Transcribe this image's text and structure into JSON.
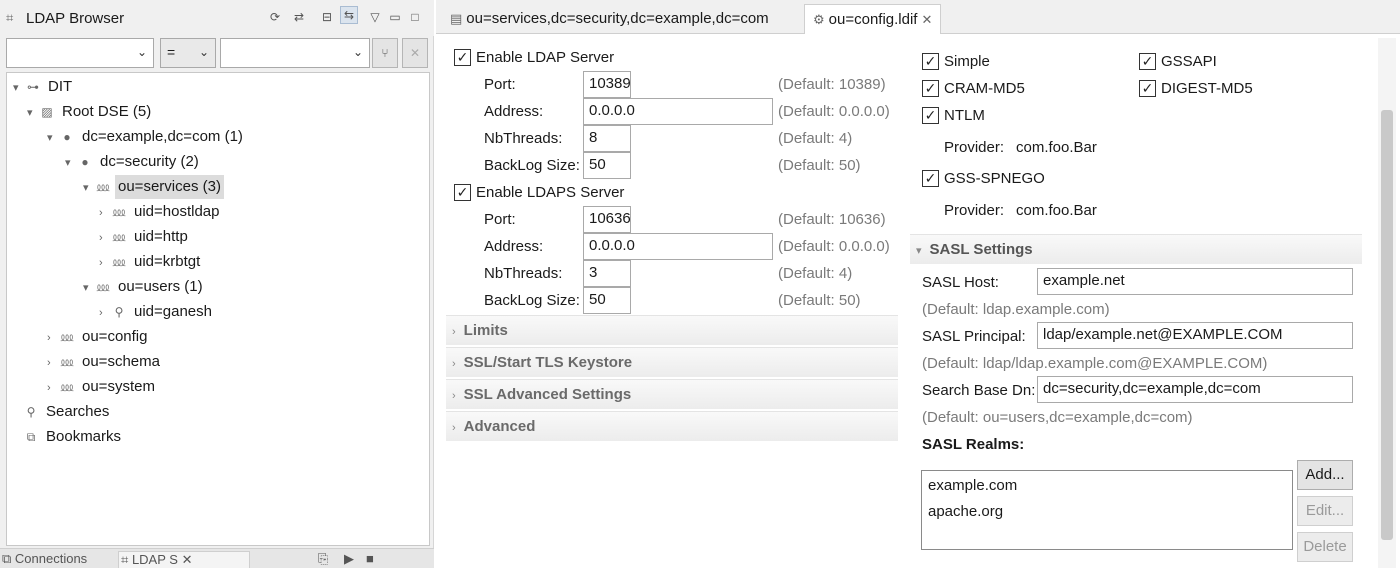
{
  "left_view": {
    "title": "LDAP Browser",
    "filter": {
      "attribute": "",
      "operator": "=",
      "value": ""
    },
    "tree": [
      {
        "label": "DIT",
        "icon": "dit-icon",
        "toggle": "▾"
      },
      {
        "label": "Root DSE (5)",
        "icon": "root-dse-icon",
        "toggle": "▾"
      },
      {
        "label": "dc=example,dc=com (1)",
        "icon": "domain-entry-icon",
        "toggle": "▾"
      },
      {
        "label": "dc=security (2)",
        "icon": "domain-entry-icon",
        "toggle": "▾"
      },
      {
        "label": "ou=services (3)",
        "icon": "ou-entry-icon",
        "toggle": "▾"
      },
      {
        "label": "uid=hostldap",
        "icon": "ou-entry-icon",
        "toggle": "›"
      },
      {
        "label": "uid=http",
        "icon": "ou-entry-icon",
        "toggle": "›"
      },
      {
        "label": "uid=krbtgt",
        "icon": "ou-entry-icon",
        "toggle": "›"
      },
      {
        "label": "ou=users (1)",
        "icon": "ou-entry-icon",
        "toggle": "▾"
      },
      {
        "label": "uid=ganesh",
        "icon": "person-entry-icon",
        "toggle": "›"
      },
      {
        "label": "ou=config",
        "icon": "ou-entry-icon",
        "toggle": "›"
      },
      {
        "label": "ou=schema",
        "icon": "ou-entry-icon",
        "toggle": "›"
      },
      {
        "label": "ou=system",
        "icon": "ou-entry-icon",
        "toggle": "›"
      },
      {
        "label": "Searches",
        "icon": "searches-icon",
        "toggle": ""
      },
      {
        "label": "Bookmarks",
        "icon": "bookmarks-icon",
        "toggle": ""
      }
    ],
    "bottom_tabs": [
      "Connections",
      "LDAP S"
    ]
  },
  "editor": {
    "tabs": [
      {
        "label": "ou=services,dc=security,dc=example,dc=com",
        "active": false
      },
      {
        "label": "ou=config.ldif",
        "active": true
      }
    ],
    "ldap": {
      "enable_label": "Enable LDAP Server",
      "enabled": true,
      "port_label": "Port:",
      "port": "10389",
      "port_default": "(Default: 10389)",
      "address_label": "Address:",
      "address": "0.0.0.0",
      "address_default": "(Default: 0.0.0.0)",
      "threads_label": "NbThreads:",
      "threads": "8",
      "threads_default": "(Default: 4)",
      "backlog_label": "BackLog Size:",
      "backlog": "50",
      "backlog_default": "(Default: 50)"
    },
    "ldaps": {
      "enable_label": "Enable LDAPS Server",
      "enabled": true,
      "port_label": "Port:",
      "port": "10636",
      "port_default": "(Default: 10636)",
      "address_label": "Address:",
      "address": "0.0.0.0",
      "address_default": "(Default: 0.0.0.0)",
      "threads_label": "NbThreads:",
      "threads": "3",
      "threads_default": "(Default: 4)",
      "backlog_label": "BackLog Size:",
      "backlog": "50",
      "backlog_default": "(Default: 50)"
    },
    "sections": [
      "Limits",
      "SSL/Start TLS Keystore",
      "SSL Advanced Settings",
      "Advanced"
    ],
    "auth_mechanisms": {
      "simple": "Simple",
      "gssapi": "GSSAPI",
      "cram_md5": "CRAM-MD5",
      "digest_md5": "DIGEST-MD5",
      "ntlm": "NTLM",
      "ntlm_provider_label": "Provider:",
      "ntlm_provider": "com.foo.Bar",
      "gss_spnego": "GSS-SPNEGO",
      "spnego_provider_label": "Provider:",
      "spnego_provider": "com.foo.Bar"
    },
    "sasl": {
      "section_title": "SASL Settings",
      "host_label": "SASL Host:",
      "host": "example.net",
      "host_default": "(Default: ldap.example.com)",
      "principal_label": "SASL Principal:",
      "principal": "ldap/example.net@EXAMPLE.COM",
      "principal_default": "(Default: ldap/ldap.example.com@EXAMPLE.COM)",
      "search_base_label": "Search Base Dn:",
      "search_base": "dc=security,dc=example,dc=com",
      "search_base_default": "(Default: ou=users,dc=example,dc=com)",
      "realms_label": "SASL Realms:",
      "realms": [
        "example.com",
        "apache.org"
      ],
      "add_label": "Add...",
      "edit_label": "Edit...",
      "delete_label": "Delete"
    }
  }
}
